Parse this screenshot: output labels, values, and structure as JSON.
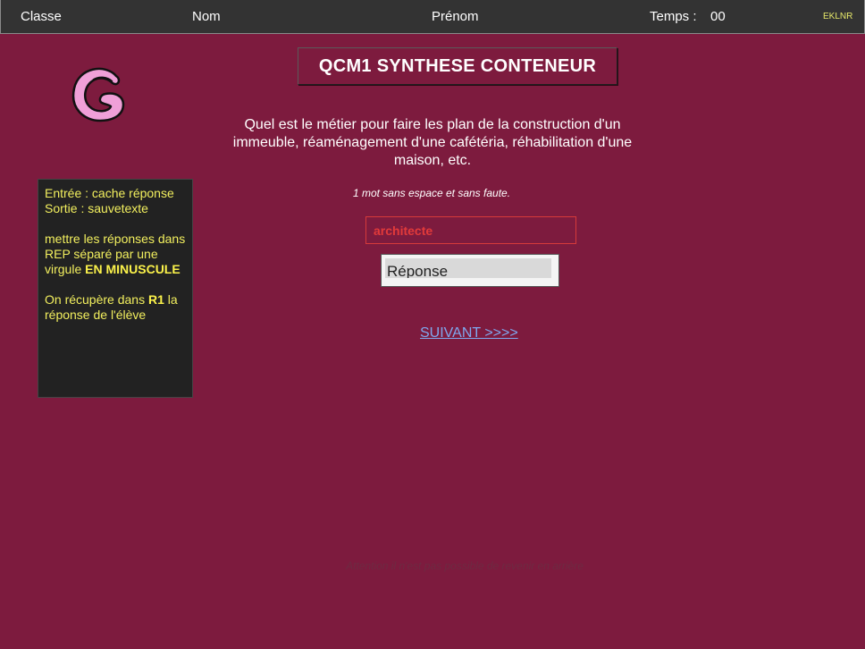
{
  "header": {
    "classe": "Classe",
    "nom": "Nom",
    "prenom": "Prénom",
    "temps_label": "Temps :",
    "temps_value": "00",
    "code": "EKLNR"
  },
  "logo": {
    "icon": "g-letter-logo",
    "color": "#f0a0d8"
  },
  "title": "QCM1 SYNTHESE CONTENEUR",
  "question": "Quel est le métier pour faire les plan de la construction d'un immeuble, réaménagement d'une cafétéria, réhabilitation d'une maison, etc.",
  "hint": "1 mot sans espace et sans faute.",
  "notes": {
    "line1": "Entrée : cache réponse",
    "line2": "Sortie : sauvetexte",
    "p2_text": "mettre les réponses dans REP séparé par une virgule ",
    "p2_bold": "EN MINUSCULE",
    "p3_text": "On récupère dans ",
    "p3_bold": "R1",
    "p3_tail": " la réponse de l'élève"
  },
  "answer": {
    "value": "architecte",
    "placeholder": ""
  },
  "reponse_button": "Réponse",
  "suivant_link": "SUIVANT >>>>",
  "warning": "Attention il n'est pas possible de revenir en arrière",
  "colors": {
    "background": "#7d1b3e",
    "topbar": "#333333",
    "notes_text": "#f2ef5e",
    "answer_text": "#e23a3a",
    "link": "#7fa8ee"
  }
}
